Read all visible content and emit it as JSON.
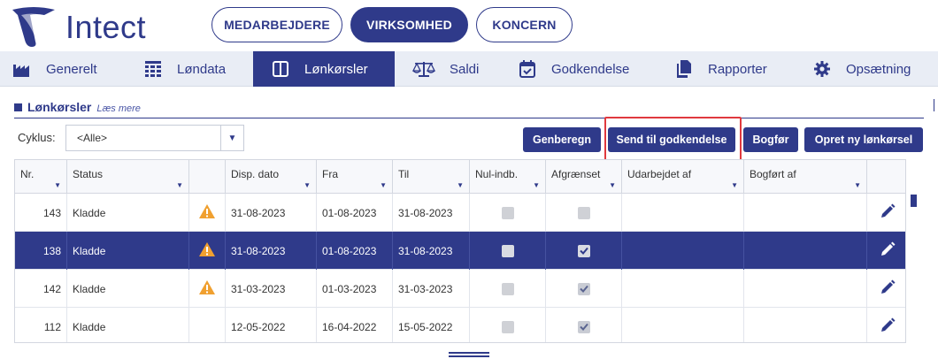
{
  "brand": {
    "name": "Intect",
    "color": "#2f3a8a"
  },
  "top_tabs": [
    {
      "label": "MEDARBEJDERE",
      "active": false
    },
    {
      "label": "VIRKSOMHED",
      "active": true
    },
    {
      "label": "KONCERN",
      "active": false
    }
  ],
  "nav": [
    {
      "label": "Generelt",
      "icon": "factory-icon",
      "active": false
    },
    {
      "label": "Løndata",
      "icon": "spreadsheet-icon",
      "active": false
    },
    {
      "label": "Lønkørsler",
      "icon": "columns-icon",
      "active": true
    },
    {
      "label": "Saldi",
      "icon": "scales-icon",
      "active": false
    },
    {
      "label": "Godkendelse",
      "icon": "calendar-check-icon",
      "active": false
    },
    {
      "label": "Rapporter",
      "icon": "documents-icon",
      "active": false
    },
    {
      "label": "Opsætning",
      "icon": "gear-icon",
      "active": false
    }
  ],
  "section": {
    "title": "Lønkørsler",
    "more_link": "Læs mere"
  },
  "filter": {
    "label": "Cyklus:",
    "selected": "<Alle>"
  },
  "actions": [
    {
      "label": "Genberegn"
    },
    {
      "label": "Send til godkendelse",
      "highlighted": true
    },
    {
      "label": "Bogfør"
    },
    {
      "label": "Opret ny lønkørsel"
    }
  ],
  "table": {
    "columns": [
      "Nr.",
      "Status",
      "",
      "Disp. dato",
      "Fra",
      "Til",
      "Nul-indb.",
      "Afgrænset",
      "Udarbejdet af",
      "Bogført af",
      ""
    ],
    "rows": [
      {
        "nr": "143",
        "status": "Kladde",
        "warning": true,
        "disp": "31-08-2023",
        "fra": "01-08-2023",
        "til": "31-08-2023",
        "nul": false,
        "afg": false,
        "udarb": "",
        "bogf": "",
        "selected": false
      },
      {
        "nr": "138",
        "status": "Kladde",
        "warning": true,
        "disp": "31-08-2023",
        "fra": "01-08-2023",
        "til": "31-08-2023",
        "nul": false,
        "afg": true,
        "udarb": "",
        "bogf": "",
        "selected": true
      },
      {
        "nr": "142",
        "status": "Kladde",
        "warning": true,
        "disp": "31-03-2023",
        "fra": "01-03-2023",
        "til": "31-03-2023",
        "nul": false,
        "afg": true,
        "udarb": "",
        "bogf": "",
        "selected": false
      },
      {
        "nr": "112",
        "status": "Kladde",
        "warning": false,
        "disp": "12-05-2022",
        "fra": "16-04-2022",
        "til": "15-05-2022",
        "nul": false,
        "afg": true,
        "udarb": "",
        "bogf": "",
        "selected": false
      }
    ]
  },
  "colors": {
    "primary": "#2f3a8a",
    "nav_bg": "#e9edf5",
    "highlight_border": "#e0393e",
    "warning": "#f0a030"
  }
}
